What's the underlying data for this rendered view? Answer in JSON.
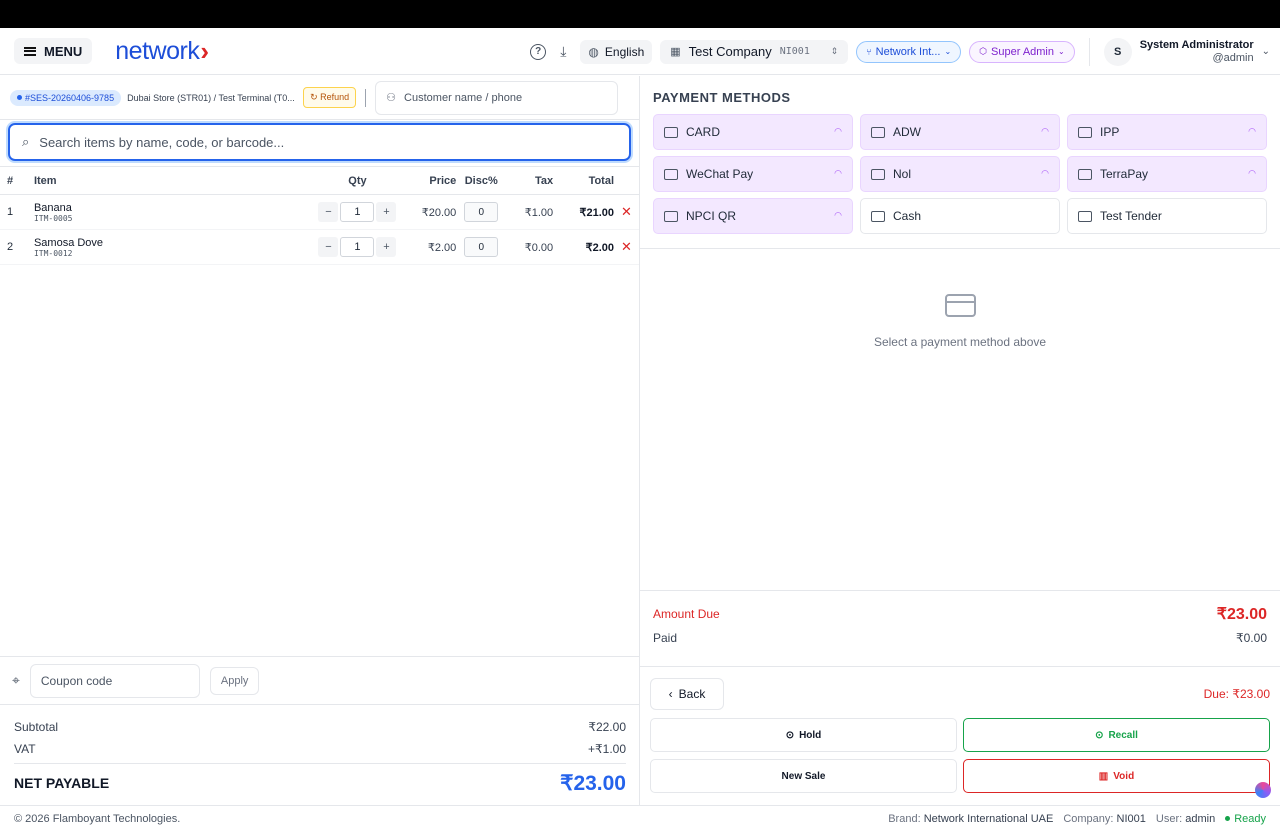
{
  "header": {
    "menu_label": "MENU",
    "logo_text": "network",
    "language": "English",
    "company_name": "Test Company",
    "company_code": "NI001",
    "network_pill": "Network Int...",
    "role_pill": "Super Admin",
    "avatar_initial": "S",
    "user_name": "System Administrator",
    "user_handle": "@admin"
  },
  "session": {
    "id": "#SES-20260406-9785",
    "store": "Dubai Store (STR01) / Test Terminal (T0...",
    "refund_label": "Refund",
    "customer_placeholder": "Customer name / phone",
    "search_placeholder": "Search items by name, code, or barcode..."
  },
  "table": {
    "headers": {
      "no": "#",
      "item": "Item",
      "qty": "Qty",
      "price": "Price",
      "disc": "Disc%",
      "tax": "Tax",
      "total": "Total"
    },
    "rows": [
      {
        "no": "1",
        "name": "Banana",
        "code": "ITM-0005",
        "qty": "1",
        "price": "₹20.00",
        "disc": "0",
        "tax": "₹1.00",
        "total": "₹21.00"
      },
      {
        "no": "2",
        "name": "Samosa Dove",
        "code": "ITM-0012",
        "qty": "1",
        "price": "₹2.00",
        "disc": "0",
        "tax": "₹0.00",
        "total": "₹2.00"
      }
    ]
  },
  "coupon": {
    "placeholder": "Coupon code",
    "apply_label": "Apply"
  },
  "totals": {
    "subtotal_label": "Subtotal",
    "subtotal": "₹22.00",
    "vat_label": "VAT",
    "vat": "+₹1.00",
    "net_label": "NET PAYABLE",
    "net": "₹23.00"
  },
  "payment": {
    "title": "PAYMENT METHODS",
    "methods": [
      {
        "label": "CARD"
      },
      {
        "label": "ADW"
      },
      {
        "label": "IPP"
      },
      {
        "label": "WeChat Pay"
      },
      {
        "label": "Nol"
      },
      {
        "label": "TerraPay"
      },
      {
        "label": "NPCI QR"
      },
      {
        "label": "Cash"
      },
      {
        "label": "Test Tender"
      }
    ],
    "hint": "Select a payment method above"
  },
  "due": {
    "amount_due_label": "Amount Due",
    "amount_due": "₹23.00",
    "paid_label": "Paid",
    "paid": "₹0.00",
    "due_small": "Due: ₹23.00"
  },
  "actions": {
    "back": "Back",
    "hold": "Hold",
    "recall": "Recall",
    "new_sale": "New Sale",
    "void": "Void"
  },
  "footer": {
    "copyright": "© 2026 Flamboyant Technologies.",
    "brand_label": "Brand:",
    "brand": "Network International UAE",
    "company_label": "Company:",
    "company": "NI001",
    "user_label": "User:",
    "user": "admin",
    "status": "Ready"
  },
  "colors": {
    "accent": "#2563eb",
    "brand_red": "#dc2626",
    "nfc_bg": "#f3e8ff",
    "success": "#16a34a"
  }
}
